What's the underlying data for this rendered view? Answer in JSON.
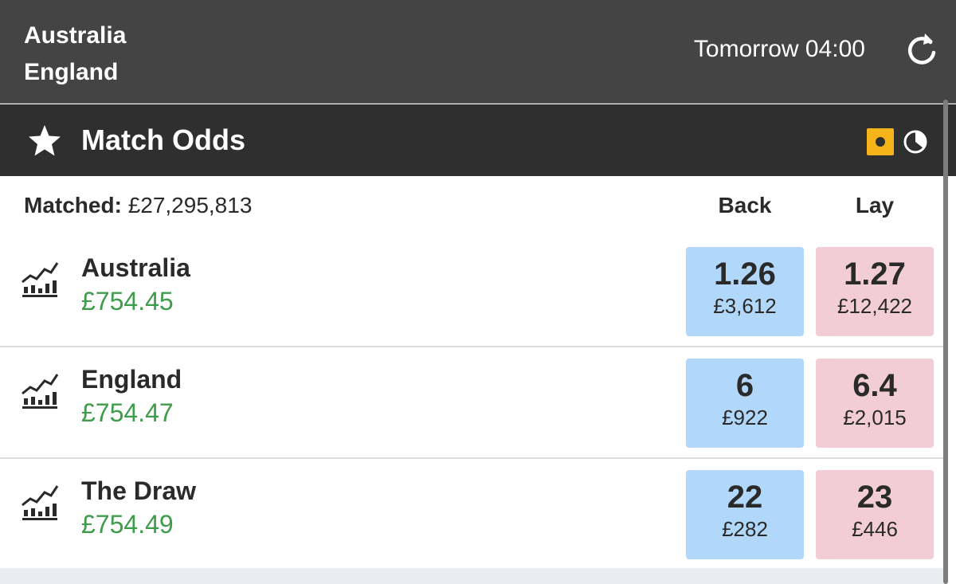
{
  "header": {
    "home_team": "Australia",
    "away_team": "England",
    "start_time": "Tomorrow 04:00",
    "refresh_icon": "refresh-icon"
  },
  "market": {
    "title": "Match Odds",
    "favourite_icon": "star-icon",
    "status_icons": [
      "in-play-icon",
      "timer-icon"
    ],
    "accent_color": "#f4b41a"
  },
  "columns": {
    "matched_label": "Matched:",
    "matched_value": "£27,295,813",
    "back_label": "Back",
    "lay_label": "Lay"
  },
  "runners": [
    {
      "name": "Australia",
      "pl": "£754.45",
      "back": {
        "odds": "1.26",
        "size": "£3,612"
      },
      "lay": {
        "odds": "1.27",
        "size": "£12,422"
      }
    },
    {
      "name": "England",
      "pl": "£754.47",
      "back": {
        "odds": "6",
        "size": "£922"
      },
      "lay": {
        "odds": "6.4",
        "size": "£2,015"
      }
    },
    {
      "name": "The Draw",
      "pl": "£754.49",
      "back": {
        "odds": "22",
        "size": "£282"
      },
      "lay": {
        "odds": "23",
        "size": "£446"
      }
    }
  ],
  "colors": {
    "header_bg": "#444444",
    "market_bar_bg": "#2f2f2f",
    "back_bg": "#b1d8fb",
    "lay_bg": "#f3cdd6",
    "profit_green": "#3e9c4b"
  }
}
